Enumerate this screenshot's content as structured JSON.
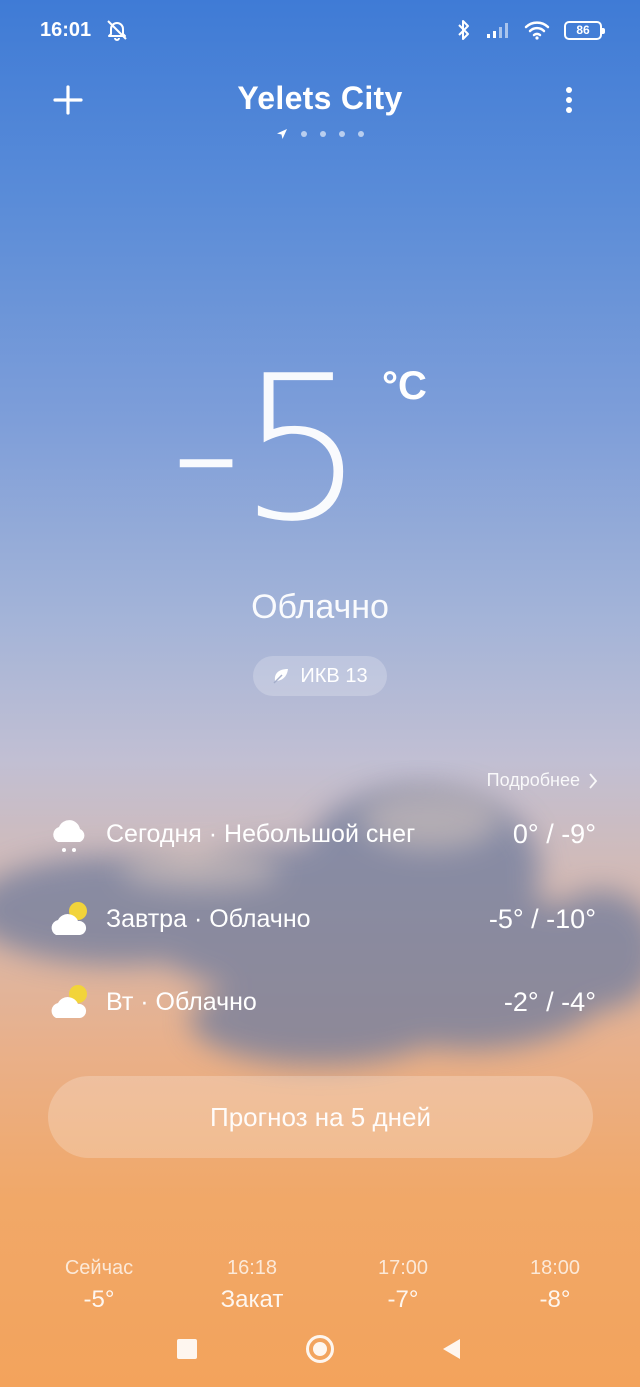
{
  "status_bar": {
    "time": "16:01",
    "battery": "86",
    "icons": [
      "mute-icon",
      "bluetooth-icon",
      "signal-icon",
      "wifi-icon",
      "battery-icon"
    ]
  },
  "header": {
    "city": "Yelets City",
    "add_icon": "plus-icon",
    "menu_icon": "more-vertical-icon",
    "page_count": 5,
    "active_page": 0
  },
  "current": {
    "temperature": "-5",
    "unit": "°C",
    "condition": "Облачно",
    "aqi_label": "ИКВ 13",
    "aqi_icon": "leaf-icon"
  },
  "details_link": "Подробнее",
  "forecast": [
    {
      "day": "Сегодня · Небольшой снег",
      "temps": "0° / -9°",
      "icon": "snow-cloud-icon"
    },
    {
      "day": "Завтра · Облачно",
      "temps": "-5° / -10°",
      "icon": "partly-cloudy-icon"
    },
    {
      "day": "Вт · Облачно",
      "temps": "-2° / -4°",
      "icon": "partly-cloudy-icon"
    }
  ],
  "five_day_button": "Прогноз на 5 дней",
  "hourly": [
    {
      "time": "Сейчас",
      "value": "-5°"
    },
    {
      "time": "16:18",
      "value": "Закат"
    },
    {
      "time": "17:00",
      "value": "-7°"
    },
    {
      "time": "18:00",
      "value": "-8°"
    }
  ],
  "colors": {
    "sky_top": "#3f7bd6",
    "sky_bottom": "#f3a35c",
    "sun": "#f2d43a"
  }
}
